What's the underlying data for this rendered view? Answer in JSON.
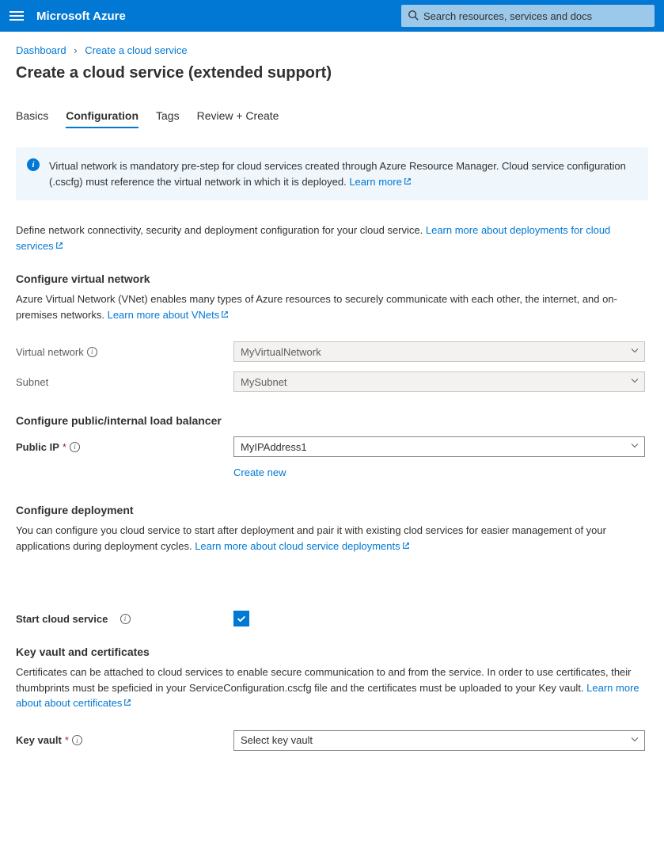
{
  "topbar": {
    "brand": "Microsoft Azure",
    "search_placeholder": "Search resources, services and docs"
  },
  "breadcrumb": {
    "items": [
      "Dashboard",
      "Create a cloud service"
    ]
  },
  "page_title": "Create a cloud service (extended support)",
  "tabs": [
    "Basics",
    "Configuration",
    "Tags",
    "Review + Create"
  ],
  "active_tab": "Configuration",
  "banner": {
    "text": "Virtual network is mandatory pre-step for cloud services created through Azure Resource Manager. Cloud service configuration (.cscfg) must reference the virtual network in which it is deployed. ",
    "link": "Learn more"
  },
  "intro": {
    "text": "Define network connectivity, security and deployment configuration for your cloud service. ",
    "link": "Learn more about deployments for cloud services"
  },
  "vnet": {
    "heading": "Configure virtual network",
    "desc": "Azure Virtual Network (VNet) enables many types of Azure resources to securely communicate with each other, the internet, and on-premises networks. ",
    "link": "Learn more about VNets",
    "virtual_network_label": "Virtual network",
    "virtual_network_value": "MyVirtualNetwork",
    "subnet_label": "Subnet",
    "subnet_value": "MySubnet"
  },
  "lb": {
    "heading": "Configure public/internal load balancer",
    "public_ip_label": "Public IP",
    "public_ip_value": "MyIPAddress1",
    "create_new": "Create new"
  },
  "deploy": {
    "heading": "Configure deployment",
    "desc": "You can configure you cloud service to start after deployment and pair it with existing clod services for easier management of your applications during deployment cycles. ",
    "link": "Learn more about cloud service deployments",
    "start_label": "Start cloud service",
    "start_checked": true
  },
  "kv": {
    "heading": "Key vault and certificates",
    "desc": "Certificates can be attached to cloud services to enable secure communication to and from the service. In order to use certificates, their thumbprints must be speficied in your ServiceConfiguration.cscfg file and the certificates must be uploaded to your Key vault. ",
    "link": "Learn more about about certificates",
    "keyvault_label": "Key vault",
    "keyvault_value": "Select key vault"
  }
}
